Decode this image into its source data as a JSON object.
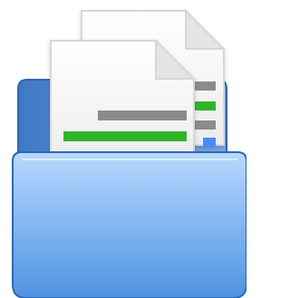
{
  "icon": {
    "name": "folder-with-documents-icon",
    "colors": {
      "folder_back_dark": "#3f78c4",
      "folder_back_light": "#79a8e6",
      "folder_front_top": "#b9d9ff",
      "folder_front_bottom": "#4f93e3",
      "folder_outline": "#2f67b1",
      "paper": "#f6f6f6",
      "paper_shadow": "#d7d7d7",
      "green_bar": "#2fb52b",
      "gray_bar": "#8b8b8b",
      "blue_bar": "#4a8cff"
    }
  }
}
